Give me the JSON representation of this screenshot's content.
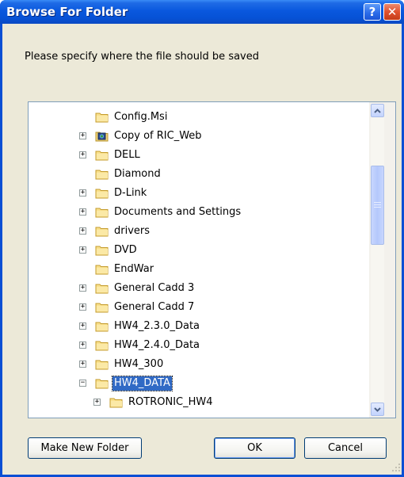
{
  "dialog": {
    "title": "Browse For Folder",
    "help_glyph": "?",
    "close_glyph": "✕",
    "prompt": "Please specify where the file should be saved"
  },
  "tree": {
    "items": [
      {
        "label": "Config.Msi",
        "expander": "",
        "icon": "folder-icon",
        "selected": false,
        "indent": 0
      },
      {
        "label": "Copy of RIC_Web",
        "expander": "+",
        "icon": "web-folder-icon",
        "selected": false,
        "indent": 0
      },
      {
        "label": "DELL",
        "expander": "+",
        "icon": "folder-icon",
        "selected": false,
        "indent": 0
      },
      {
        "label": "Diamond",
        "expander": "",
        "icon": "folder-icon",
        "selected": false,
        "indent": 0
      },
      {
        "label": "D-Link",
        "expander": "+",
        "icon": "folder-icon",
        "selected": false,
        "indent": 0
      },
      {
        "label": "Documents and Settings",
        "expander": "+",
        "icon": "folder-icon",
        "selected": false,
        "indent": 0
      },
      {
        "label": "drivers",
        "expander": "+",
        "icon": "folder-icon",
        "selected": false,
        "indent": 0
      },
      {
        "label": "DVD",
        "expander": "+",
        "icon": "folder-icon",
        "selected": false,
        "indent": 0
      },
      {
        "label": "EndWar",
        "expander": "",
        "icon": "folder-icon",
        "selected": false,
        "indent": 0
      },
      {
        "label": "General Cadd 3",
        "expander": "+",
        "icon": "folder-icon",
        "selected": false,
        "indent": 0
      },
      {
        "label": "General Cadd 7",
        "expander": "+",
        "icon": "folder-icon",
        "selected": false,
        "indent": 0
      },
      {
        "label": "HW4_2.3.0_Data",
        "expander": "+",
        "icon": "folder-icon",
        "selected": false,
        "indent": 0
      },
      {
        "label": "HW4_2.4.0_Data",
        "expander": "+",
        "icon": "folder-icon",
        "selected": false,
        "indent": 0
      },
      {
        "label": "HW4_300",
        "expander": "+",
        "icon": "folder-icon",
        "selected": false,
        "indent": 0
      },
      {
        "label": "HW4_DATA",
        "expander": "−",
        "icon": "open-folder-icon",
        "selected": true,
        "indent": 0
      },
      {
        "label": "ROTRONIC_HW4",
        "expander": "+",
        "icon": "folder-icon",
        "selected": false,
        "indent": 1
      }
    ]
  },
  "buttons": {
    "make_new_folder": "Make New Folder",
    "ok": "OK",
    "cancel": "Cancel"
  },
  "colors": {
    "title_bar": "#0a58de",
    "dialog_face": "#ece9d8",
    "selection": "#316ac5"
  }
}
